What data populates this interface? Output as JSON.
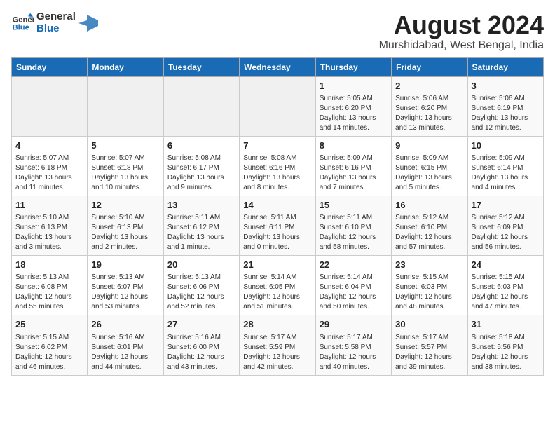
{
  "header": {
    "logo_line1": "General",
    "logo_line2": "Blue",
    "month_year": "August 2024",
    "location": "Murshidabad, West Bengal, India"
  },
  "weekdays": [
    "Sunday",
    "Monday",
    "Tuesday",
    "Wednesday",
    "Thursday",
    "Friday",
    "Saturday"
  ],
  "weeks": [
    [
      {
        "day": "",
        "info": ""
      },
      {
        "day": "",
        "info": ""
      },
      {
        "day": "",
        "info": ""
      },
      {
        "day": "",
        "info": ""
      },
      {
        "day": "1",
        "info": "Sunrise: 5:05 AM\nSunset: 6:20 PM\nDaylight: 13 hours\nand 14 minutes."
      },
      {
        "day": "2",
        "info": "Sunrise: 5:06 AM\nSunset: 6:20 PM\nDaylight: 13 hours\nand 13 minutes."
      },
      {
        "day": "3",
        "info": "Sunrise: 5:06 AM\nSunset: 6:19 PM\nDaylight: 13 hours\nand 12 minutes."
      }
    ],
    [
      {
        "day": "4",
        "info": "Sunrise: 5:07 AM\nSunset: 6:18 PM\nDaylight: 13 hours\nand 11 minutes."
      },
      {
        "day": "5",
        "info": "Sunrise: 5:07 AM\nSunset: 6:18 PM\nDaylight: 13 hours\nand 10 minutes."
      },
      {
        "day": "6",
        "info": "Sunrise: 5:08 AM\nSunset: 6:17 PM\nDaylight: 13 hours\nand 9 minutes."
      },
      {
        "day": "7",
        "info": "Sunrise: 5:08 AM\nSunset: 6:16 PM\nDaylight: 13 hours\nand 8 minutes."
      },
      {
        "day": "8",
        "info": "Sunrise: 5:09 AM\nSunset: 6:16 PM\nDaylight: 13 hours\nand 7 minutes."
      },
      {
        "day": "9",
        "info": "Sunrise: 5:09 AM\nSunset: 6:15 PM\nDaylight: 13 hours\nand 5 minutes."
      },
      {
        "day": "10",
        "info": "Sunrise: 5:09 AM\nSunset: 6:14 PM\nDaylight: 13 hours\nand 4 minutes."
      }
    ],
    [
      {
        "day": "11",
        "info": "Sunrise: 5:10 AM\nSunset: 6:13 PM\nDaylight: 13 hours\nand 3 minutes."
      },
      {
        "day": "12",
        "info": "Sunrise: 5:10 AM\nSunset: 6:13 PM\nDaylight: 13 hours\nand 2 minutes."
      },
      {
        "day": "13",
        "info": "Sunrise: 5:11 AM\nSunset: 6:12 PM\nDaylight: 13 hours\nand 1 minute."
      },
      {
        "day": "14",
        "info": "Sunrise: 5:11 AM\nSunset: 6:11 PM\nDaylight: 13 hours\nand 0 minutes."
      },
      {
        "day": "15",
        "info": "Sunrise: 5:11 AM\nSunset: 6:10 PM\nDaylight: 12 hours\nand 58 minutes."
      },
      {
        "day": "16",
        "info": "Sunrise: 5:12 AM\nSunset: 6:10 PM\nDaylight: 12 hours\nand 57 minutes."
      },
      {
        "day": "17",
        "info": "Sunrise: 5:12 AM\nSunset: 6:09 PM\nDaylight: 12 hours\nand 56 minutes."
      }
    ],
    [
      {
        "day": "18",
        "info": "Sunrise: 5:13 AM\nSunset: 6:08 PM\nDaylight: 12 hours\nand 55 minutes."
      },
      {
        "day": "19",
        "info": "Sunrise: 5:13 AM\nSunset: 6:07 PM\nDaylight: 12 hours\nand 53 minutes."
      },
      {
        "day": "20",
        "info": "Sunrise: 5:13 AM\nSunset: 6:06 PM\nDaylight: 12 hours\nand 52 minutes."
      },
      {
        "day": "21",
        "info": "Sunrise: 5:14 AM\nSunset: 6:05 PM\nDaylight: 12 hours\nand 51 minutes."
      },
      {
        "day": "22",
        "info": "Sunrise: 5:14 AM\nSunset: 6:04 PM\nDaylight: 12 hours\nand 50 minutes."
      },
      {
        "day": "23",
        "info": "Sunrise: 5:15 AM\nSunset: 6:03 PM\nDaylight: 12 hours\nand 48 minutes."
      },
      {
        "day": "24",
        "info": "Sunrise: 5:15 AM\nSunset: 6:03 PM\nDaylight: 12 hours\nand 47 minutes."
      }
    ],
    [
      {
        "day": "25",
        "info": "Sunrise: 5:15 AM\nSunset: 6:02 PM\nDaylight: 12 hours\nand 46 minutes."
      },
      {
        "day": "26",
        "info": "Sunrise: 5:16 AM\nSunset: 6:01 PM\nDaylight: 12 hours\nand 44 minutes."
      },
      {
        "day": "27",
        "info": "Sunrise: 5:16 AM\nSunset: 6:00 PM\nDaylight: 12 hours\nand 43 minutes."
      },
      {
        "day": "28",
        "info": "Sunrise: 5:17 AM\nSunset: 5:59 PM\nDaylight: 12 hours\nand 42 minutes."
      },
      {
        "day": "29",
        "info": "Sunrise: 5:17 AM\nSunset: 5:58 PM\nDaylight: 12 hours\nand 40 minutes."
      },
      {
        "day": "30",
        "info": "Sunrise: 5:17 AM\nSunset: 5:57 PM\nDaylight: 12 hours\nand 39 minutes."
      },
      {
        "day": "31",
        "info": "Sunrise: 5:18 AM\nSunset: 5:56 PM\nDaylight: 12 hours\nand 38 minutes."
      }
    ]
  ]
}
